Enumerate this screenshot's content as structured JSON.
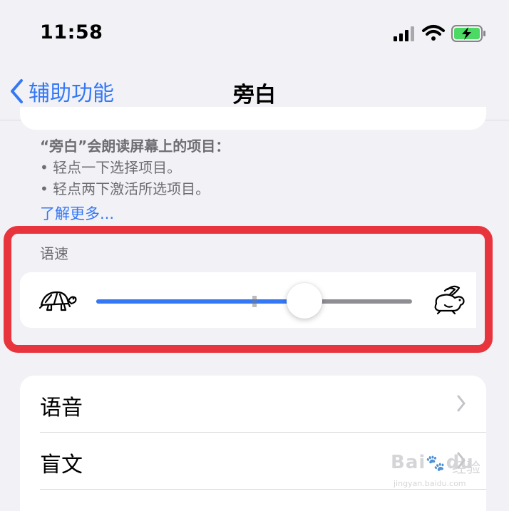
{
  "status_bar": {
    "time": "11:58",
    "icons": [
      "cellular-signal-icon",
      "wifi-icon",
      "battery-charging-icon"
    ],
    "battery_color": "#4cd964"
  },
  "nav": {
    "back_label": "辅助功能",
    "title": "旁白"
  },
  "description": {
    "heading": "“旁白”会朗读屏幕上的项目：",
    "bullets": [
      "•  轻点一下选择项目。",
      "•  轻点两下激活所选项目。"
    ],
    "learn_more": "了解更多..."
  },
  "speaking_rate": {
    "header": "语速",
    "value_fraction": 0.66,
    "midpoint_tick_fraction": 0.5,
    "left_icon": "turtle-icon",
    "right_icon": "rabbit-icon"
  },
  "options": [
    {
      "label": "语音"
    },
    {
      "label": "盲文"
    }
  ],
  "watermark": {
    "brand": "Bai",
    "brand_suffix": "du",
    "sub": "经验",
    "url": "jingyan.baidu.com"
  },
  "colors": {
    "accent": "#3478f6",
    "highlight": "#e8353d",
    "background": "#f2f2f6",
    "secondary_text": "#6d6d72"
  }
}
